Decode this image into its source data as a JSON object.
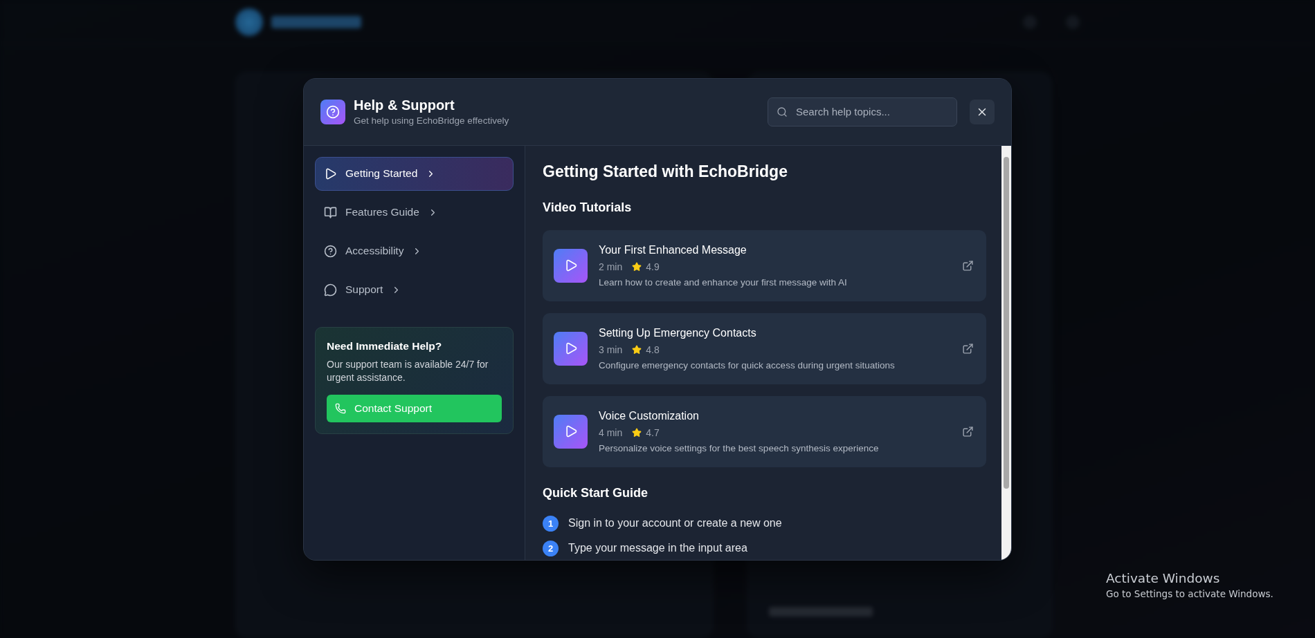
{
  "dialog": {
    "title": "Help & Support",
    "subtitle": "Get help using EchoBridge effectively",
    "search": {
      "placeholder": "Search help topics..."
    }
  },
  "nav": [
    {
      "label": "Getting Started",
      "selected": true
    },
    {
      "label": "Features Guide",
      "selected": false
    },
    {
      "label": "Accessibility",
      "selected": false
    },
    {
      "label": "Support",
      "selected": false
    }
  ],
  "help_card": {
    "title": "Need Immediate Help?",
    "text": "Our support team is available 24/7 for urgent assistance.",
    "button": "Contact Support"
  },
  "content": {
    "title": "Getting Started with EchoBridge",
    "sections": [
      {
        "kind": "videos",
        "heading": "Video Tutorials",
        "items": [
          {
            "title": "Your First Enhanced Message",
            "duration": "2 min",
            "rating": "4.9",
            "description": "Learn how to create and enhance your first message with AI"
          },
          {
            "title": "Setting Up Emergency Contacts",
            "duration": "3 min",
            "rating": "4.8",
            "description": "Configure emergency contacts for quick access during urgent situations"
          },
          {
            "title": "Voice Customization",
            "duration": "4 min",
            "rating": "4.7",
            "description": "Personalize voice settings for the best speech synthesis experience"
          }
        ]
      },
      {
        "kind": "steps",
        "heading": "Quick Start Guide",
        "items": [
          {
            "number": "1",
            "text": "Sign in to your account or create a new one"
          },
          {
            "number": "2",
            "text": "Type your message in the input area"
          }
        ]
      }
    ]
  },
  "os_notice": {
    "title": "Activate Windows",
    "text": "Go to Settings to activate Windows."
  }
}
